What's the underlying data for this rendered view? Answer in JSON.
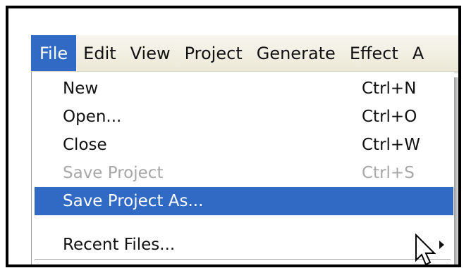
{
  "menubar": {
    "items": [
      {
        "label": "File",
        "active": true
      },
      {
        "label": "Edit"
      },
      {
        "label": "View"
      },
      {
        "label": "Project"
      },
      {
        "label": "Generate"
      },
      {
        "label": "Effect"
      },
      {
        "label": "A"
      }
    ]
  },
  "file_menu": {
    "items": [
      {
        "label": "New",
        "shortcut": "Ctrl+N",
        "enabled": true
      },
      {
        "label": "Open...",
        "shortcut": "Ctrl+O",
        "enabled": true
      },
      {
        "label": "Close",
        "shortcut": "Ctrl+W",
        "enabled": true
      },
      {
        "label": "Save Project",
        "shortcut": "Ctrl+S",
        "enabled": false
      },
      {
        "label": "Save Project As...",
        "shortcut": "",
        "enabled": true,
        "highlighted": true
      },
      {
        "label": "Recent Files...",
        "shortcut": "",
        "enabled": true,
        "has_submenu": true
      }
    ]
  },
  "colors": {
    "highlight": "#316ac5",
    "disabled_text": "#a7a7a7",
    "menubar_bg": "#ece9d8"
  },
  "icons": {
    "cursor": "arrow-cursor-icon",
    "submenu": "submenu-arrow-icon"
  }
}
